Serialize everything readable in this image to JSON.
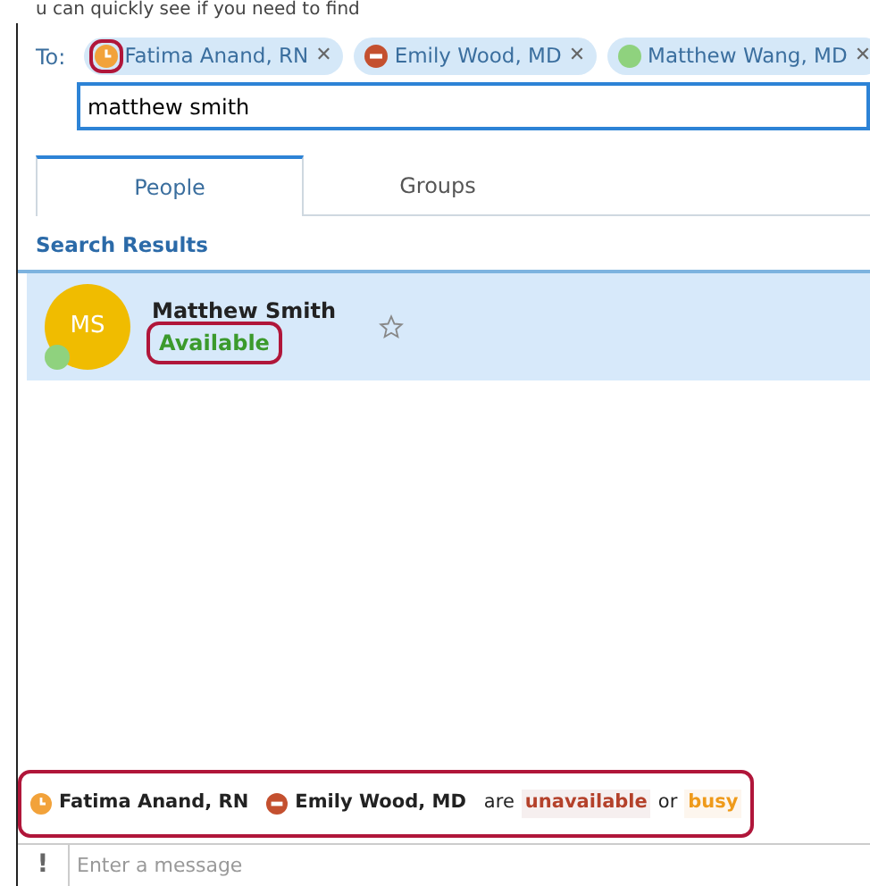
{
  "caption": "u can quickly see if you need to find",
  "to_label": "To:",
  "recipients": [
    {
      "name": "Fatima Anand, RN",
      "kind": "away",
      "highlighted": true,
      "remove": "✕"
    },
    {
      "name": "Emily Wood, MD",
      "kind": "busy",
      "highlighted": false,
      "remove": "✕"
    },
    {
      "name": "Matthew Wang, MD",
      "kind": "available",
      "highlighted": false,
      "remove": "✕"
    }
  ],
  "search": {
    "value": "matthew smith"
  },
  "tabs": [
    {
      "label": "People",
      "selected": true
    },
    {
      "label": "Groups",
      "selected": false
    }
  ],
  "results_heading": "Search Results",
  "results": [
    {
      "initials": "MS",
      "name": "Matthew Smith",
      "kind": "available",
      "status_text": "Available",
      "status_highlighted": true,
      "selected": true,
      "starred": false
    }
  ],
  "notice": {
    "highlighted": true,
    "people": [
      {
        "name": "Fatima Anand, RN",
        "kind": "away"
      },
      {
        "name": "Emily Wood, MD",
        "kind": "busy"
      }
    ],
    "text_are": "are",
    "unavailable": "unavailable",
    "text_or": "or",
    "busy": "busy"
  },
  "message": {
    "priority": "!",
    "placeholder": "Enter a message"
  }
}
